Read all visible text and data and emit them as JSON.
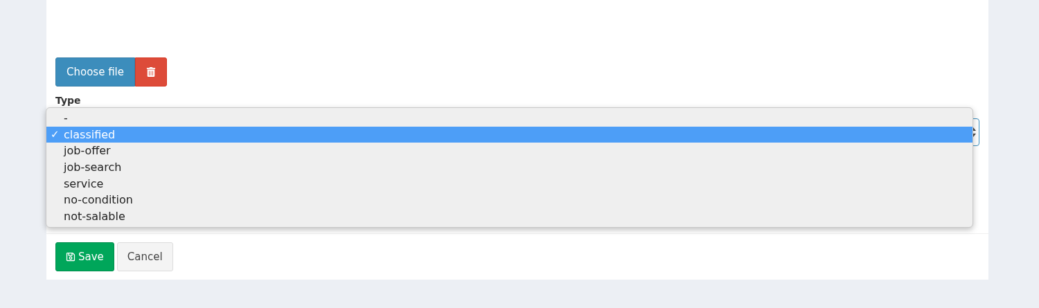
{
  "file_input": {
    "choose_label": "Choose file"
  },
  "type_field": {
    "label": "Type",
    "options": [
      {
        "label": "-",
        "selected": false
      },
      {
        "label": "classified",
        "selected": true
      },
      {
        "label": "job-offer",
        "selected": false
      },
      {
        "label": "job-search",
        "selected": false
      },
      {
        "label": "service",
        "selected": false
      },
      {
        "label": "no-condition",
        "selected": false
      },
      {
        "label": "not-salable",
        "selected": false
      }
    ],
    "check_mark": "✓"
  },
  "buttons": [
    {
      "kind": "save",
      "label": "Save"
    },
    {
      "kind": "cancel",
      "label": "Cancel"
    }
  ]
}
